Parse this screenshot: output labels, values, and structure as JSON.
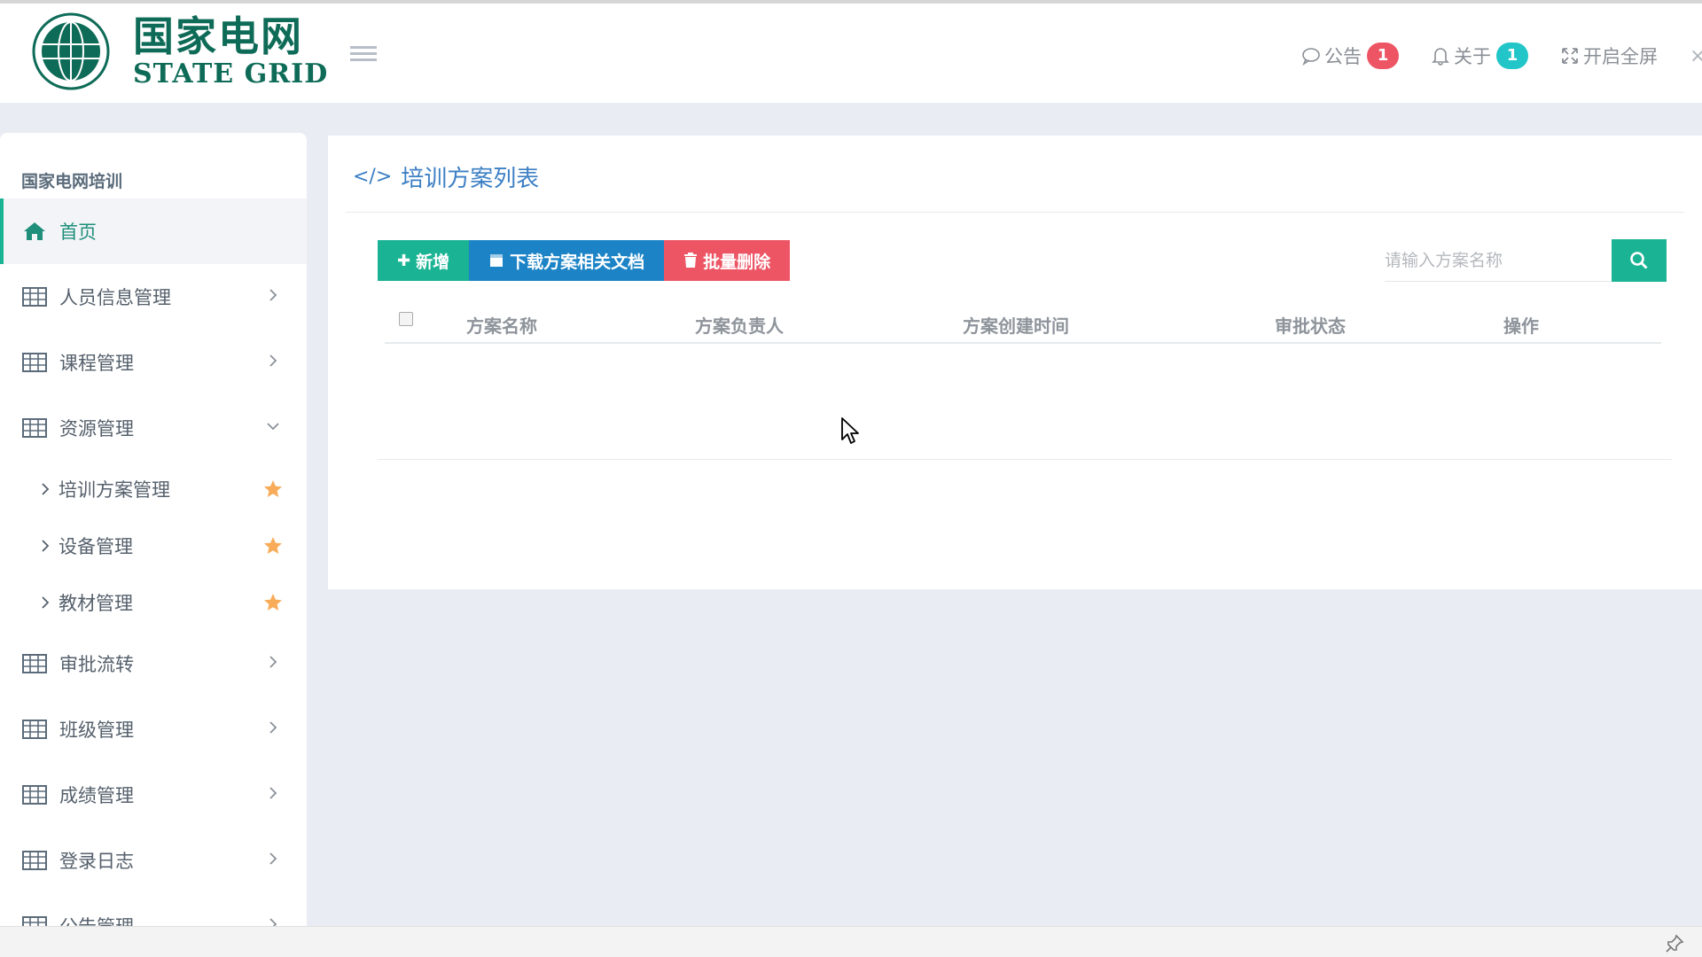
{
  "brand": {
    "name_cn": "国家电网",
    "name_en": "STATE GRID"
  },
  "header": {
    "notice_label": "公告",
    "notice_count": "1",
    "about_label": "关于",
    "about_count": "1",
    "fullscreen_label": "开启全屏"
  },
  "sidebar": {
    "title": "国家电网培训",
    "items": [
      {
        "label": "首页",
        "icon": "home-icon"
      },
      {
        "label": "人员信息管理",
        "icon": "table-icon"
      },
      {
        "label": "课程管理",
        "icon": "table-icon"
      },
      {
        "label": "资源管理",
        "icon": "table-icon"
      },
      {
        "label": "审批流转",
        "icon": "table-icon"
      },
      {
        "label": "班级管理",
        "icon": "table-icon"
      },
      {
        "label": "成绩管理",
        "icon": "table-icon"
      },
      {
        "label": "登录日志",
        "icon": "table-icon"
      },
      {
        "label": "公告管理",
        "icon": "table-icon"
      }
    ],
    "sub_items": [
      {
        "label": "培训方案管理"
      },
      {
        "label": "设备管理"
      },
      {
        "label": "教材管理"
      }
    ]
  },
  "main": {
    "title": "培训方案列表",
    "toolbar": {
      "add_label": "新增",
      "download_label": "下载方案相关文档",
      "batch_delete_label": "批量删除"
    },
    "search": {
      "placeholder": "请输入方案名称",
      "value": ""
    },
    "table": {
      "columns": [
        "方案名称",
        "方案负责人",
        "方案创建时间",
        "审批状态",
        "操作"
      ],
      "rows": []
    }
  },
  "colors": {
    "primary": "#1ab394",
    "blue": "#1c84c6",
    "danger": "#ed5565",
    "info": "#23c6c8",
    "brand_green": "#0e6b57",
    "title_blue": "#3c7fc4",
    "star": "#f8ac59"
  }
}
